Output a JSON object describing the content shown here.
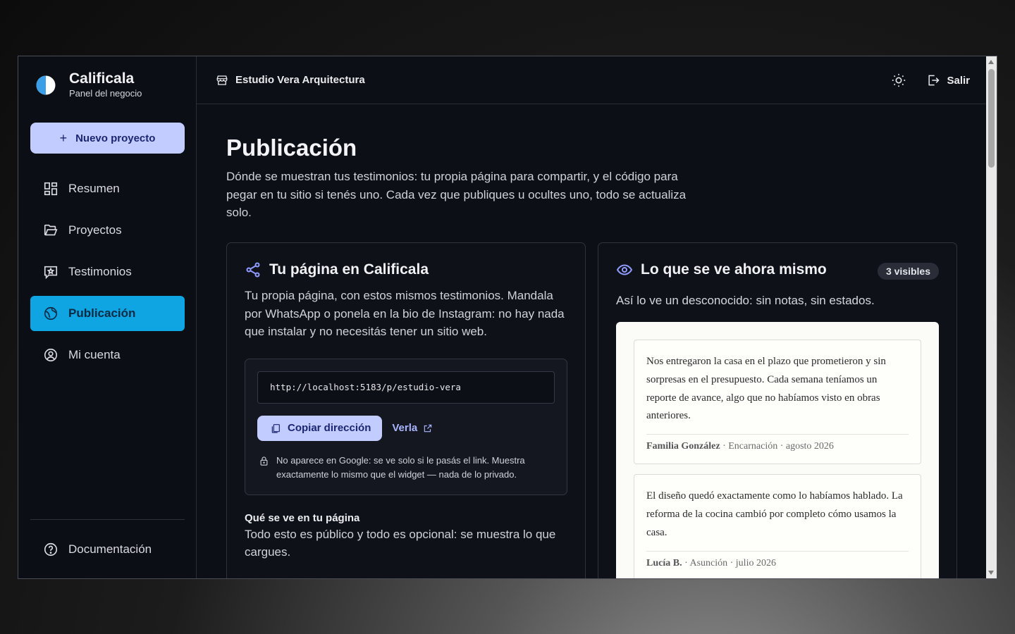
{
  "app": {
    "name": "Calificala",
    "subtitle": "Panel del negocio",
    "new_project_label": "Nuevo proyecto"
  },
  "sidebar": {
    "items": [
      {
        "label": "Resumen",
        "icon": "dashboard-icon"
      },
      {
        "label": "Proyectos",
        "icon": "folder-icon"
      },
      {
        "label": "Testimonios",
        "icon": "star-message-icon"
      },
      {
        "label": "Publicación",
        "icon": "globe-icon",
        "active": true
      },
      {
        "label": "Mi cuenta",
        "icon": "user-circle-icon"
      }
    ],
    "documentation_label": "Documentación"
  },
  "topbar": {
    "business_name": "Estudio Vera Arquitectura",
    "logout_label": "Salir"
  },
  "page": {
    "title": "Publicación",
    "description": "Dónde se muestran tus testimonios: tu propia página para compartir, y el código para pegar en tu sitio si tenés uno. Cada vez que publiques u ocultes uno, todo se actualiza solo."
  },
  "share_card": {
    "title": "Tu página en Calificala",
    "description": "Tu propia página, con estos mismos testimonios. Mandala por WhatsApp o ponela en la bio de Instagram: no hay nada que instalar y no necesitás tener un sitio web.",
    "url": "http://localhost:5183/p/estudio-vera",
    "copy_label": "Copiar dirección",
    "view_label": "Verla",
    "privacy_note": "No aparece en Google: se ve solo si le pasás el link. Muestra exactamente lo mismo que el widget — nada de lo privado.",
    "section_title": "Qué se ve en tu página",
    "section_text": "Todo esto es público y todo es opcional: se muestra lo que cargues."
  },
  "preview_card": {
    "title": "Lo que se ve ahora mismo",
    "badge": "3 visibles",
    "subtitle": "Así lo ve un desconocido: sin notas, sin estados.",
    "testimonials": [
      {
        "quote": "Nos entregaron la casa en el plazo que prometieron y sin sorpresas en el presupuesto. Cada semana teníamos un reporte de avance, algo que no habíamos visto en obras anteriores.",
        "author": "Familia González",
        "meta": " · Encarnación · agosto 2026"
      },
      {
        "quote": "El diseño quedó exactamente como lo habíamos hablado. La reforma de la cocina cambió por completo cómo usamos la casa.",
        "author": "Lucía B.",
        "meta": " · Asunción · julio 2026"
      }
    ]
  },
  "colors": {
    "accent": "#0ea5e2",
    "button_bg": "#c3ccff",
    "button_text": "#1b2673",
    "link": "#a8b4ff",
    "background": "#0d0f16"
  }
}
